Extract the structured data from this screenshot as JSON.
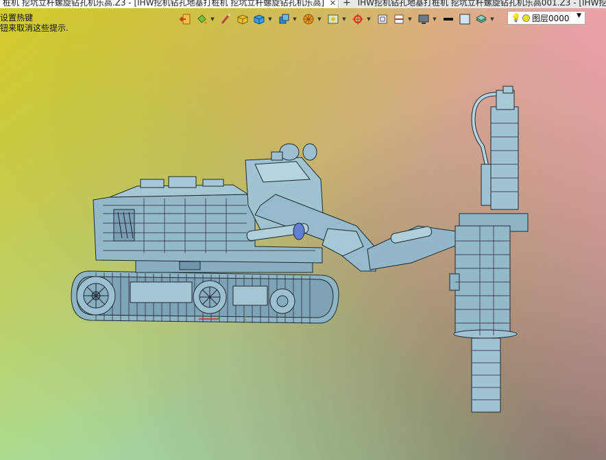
{
  "tabs": [
    {
      "label": "桩机 挖坑立杆螺旋钻孔机乐高.Z3 - [IHW挖机钻孔地基打桩机 挖坑立杆螺旋钻孔机乐高]",
      "active": true,
      "close": "✕"
    },
    {
      "label": "IHW挖机钻孔地基打桩机 挖坑立杆螺旋钻孔机乐高001.Z3 - [IHW挖",
      "active": false,
      "add": "+"
    }
  ],
  "hint": {
    "line1": "设置热键",
    "line2": "钮来取消这些提示."
  },
  "toolbar": {
    "icons": [
      "exit-icon",
      "paint-bucket-icon",
      "brush-icon",
      "box-yellow-icon",
      "box-blue-icon",
      "cube-stack-icon",
      "wheel-icon",
      "view-frame-icon",
      "crosshair-icon",
      "sketch-icon",
      "section-icon",
      "display-icon",
      "line-color-icon",
      "fill-color-icon",
      "layers-icon"
    ],
    "dropdown_caret": "▼"
  },
  "layer": {
    "label": "图层0000",
    "caret": "▼",
    "colors": {
      "dot": "#e8e020"
    }
  },
  "model": {
    "body_color": "#8fb4c4",
    "edge_color": "#1c2a33"
  }
}
